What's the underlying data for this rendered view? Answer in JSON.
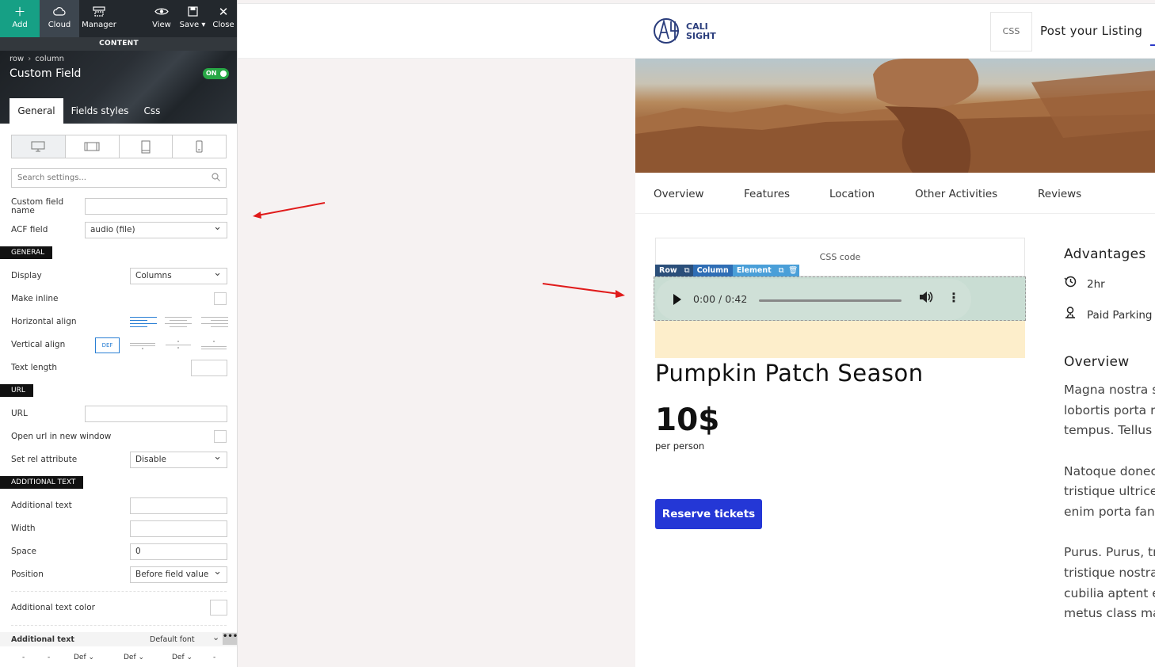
{
  "toolbar": {
    "add": "Add",
    "cloud": "Cloud",
    "manager": "Manager",
    "view": "View",
    "save": "Save",
    "close": "Close",
    "content": "CONTENT",
    "icons": {
      "add": "plus-icon",
      "cloud": "cloud-icon",
      "manager": "manager-icon",
      "view": "eye-icon",
      "save": "floppy-icon",
      "close": "close-icon"
    }
  },
  "panel": {
    "breadcrumb": [
      "row",
      "column"
    ],
    "title": "Custom Field",
    "toggle": "ON",
    "tabs": [
      "General",
      "Fields styles",
      "Css"
    ],
    "devices": [
      "desktop-icon",
      "tablet-landscape-icon",
      "tablet-portrait-icon",
      "mobile-icon"
    ],
    "search_placeholder": "Search settings...",
    "fields": {
      "custom_field_name": "Custom field name",
      "acf_field": "ACF field",
      "acf_field_value": "audio (file)",
      "display": "Display",
      "display_value": "Columns",
      "make_inline": "Make inline",
      "horizontal_align": "Horizontal align",
      "vertical_align": "Vertical align",
      "vertical_default": "DEF",
      "text_length": "Text length",
      "url": "URL",
      "open_new_window": "Open url in new window",
      "set_rel": "Set rel attribute",
      "set_rel_value": "Disable",
      "additional_text": "Additional text",
      "width": "Width",
      "space": "Space",
      "space_value": "0",
      "position": "Position",
      "position_value": "Before field value",
      "additional_text_color": "Additional text color",
      "additional_text_font_label": "Additional text",
      "additional_text_font": "Default font"
    },
    "sections": {
      "general": "GENERAL",
      "url": "URL",
      "additional_text": "ADDITIONAL TEXT"
    },
    "mini_row": [
      "-",
      "-",
      "Def",
      "Def",
      "Def",
      "-"
    ]
  },
  "site": {
    "logo_text_line1": "CALI",
    "logo_text_line2": "SIGHT",
    "header_css": "CSS code",
    "post_listing": "Post your Listing",
    "nav": [
      "Overview",
      "Features",
      "Location",
      "Other Activities",
      "Reviews"
    ],
    "block_css": "CSS code",
    "editor_crumbs": [
      "Row",
      "Column",
      "Element"
    ],
    "audio_time": "0:00 / 0:42",
    "listing_title": "Pumpkin Patch Season",
    "price": "10$",
    "per_person": "per person",
    "reserve": "Reserve tickets",
    "advantages_title": "Advantages",
    "advantages": [
      {
        "icon": "clock-icon",
        "label": "2hr"
      },
      {
        "icon": "parking-icon",
        "label": "Paid Parking"
      }
    ],
    "overview_title": "Overview",
    "overview_lines": [
      "Magna nostra s",
      "lobortis porta r",
      "tempus. Tellus s",
      "",
      "Natoque donec",
      "tristique ultrice",
      "enim porta fan",
      "",
      "Purus. Purus, tr",
      "tristique nostra",
      "cubilia aptent e",
      "metus class ma"
    ]
  },
  "colors": {
    "toolbar_bg": "#23282d",
    "add_btn": "#16a085",
    "accent_blue": "#2437d6",
    "annotation_arrow": "#e01b1b",
    "toggle_on": "#28a745",
    "crumb_row": "#2b4f7a",
    "crumb_column": "#2f6eb5",
    "crumb_element": "#4a9fd8"
  }
}
